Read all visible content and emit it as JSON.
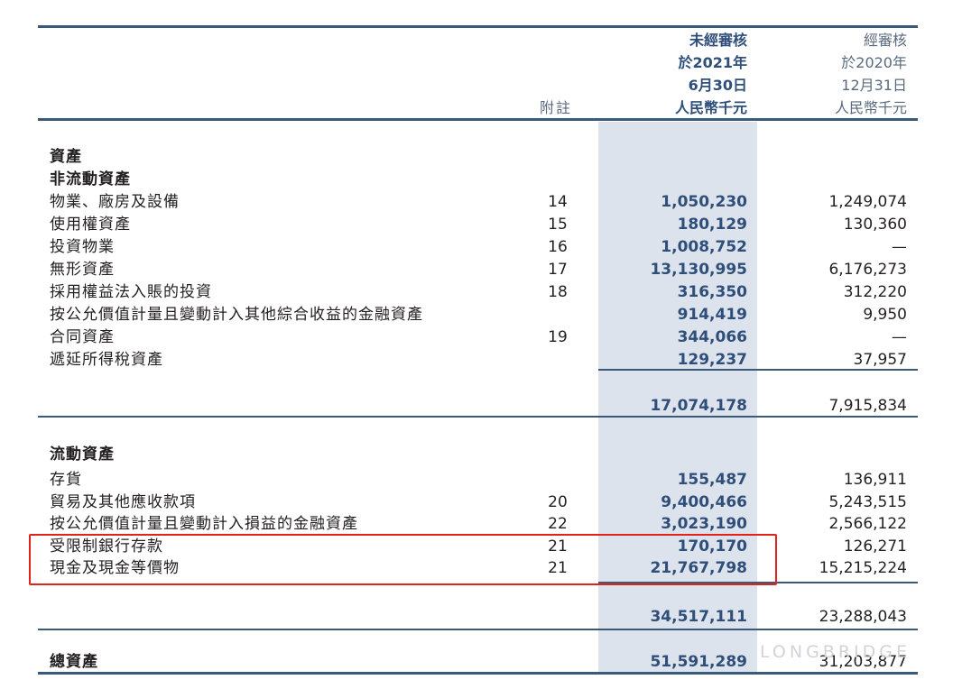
{
  "header": {
    "current": [
      "未經審核",
      "於2021年",
      "6月30日",
      "人民幣千元"
    ],
    "prior": [
      "經審核",
      "於2020年",
      "12月31日",
      "人民幣千元"
    ],
    "note_label": "附註"
  },
  "assets_heading": "資產",
  "noncurrent": {
    "heading": "非流動資產",
    "rows": [
      {
        "label": "物業、廠房及設備",
        "note": "14",
        "current": "1,050,230",
        "prior": "1,249,074"
      },
      {
        "label": "使用權資產",
        "note": "15",
        "current": "180,129",
        "prior": "130,360"
      },
      {
        "label": "投資物業",
        "note": "16",
        "current": "1,008,752",
        "prior": "—"
      },
      {
        "label": "無形資產",
        "note": "17",
        "current": "13,130,995",
        "prior": "6,176,273"
      },
      {
        "label": "採用權益法入賬的投資",
        "note": "18",
        "current": "316,350",
        "prior": "312,220"
      },
      {
        "label": "按公允價值計量且變動計入其他綜合收益的金融資產",
        "note": "",
        "current": "914,419",
        "prior": "9,950"
      },
      {
        "label": "合同資產",
        "note": "19",
        "current": "344,066",
        "prior": "—"
      },
      {
        "label": "遞延所得稅資產",
        "note": "",
        "current": "129,237",
        "prior": "37,957"
      }
    ],
    "subtotal_current": "17,074,178",
    "subtotal_prior": "7,915,834"
  },
  "currentassets": {
    "heading": "流動資產",
    "rows": [
      {
        "label": "存貨",
        "note": "",
        "current": "155,487",
        "prior": "136,911"
      },
      {
        "label": "貿易及其他應收款項",
        "note": "20",
        "current": "9,400,466",
        "prior": "5,243,515"
      },
      {
        "label": "按公允價值計量且變動計入損益的金融資產",
        "note": "22",
        "current": "3,023,190",
        "prior": "2,566,122"
      },
      {
        "label": "受限制銀行存款",
        "note": "21",
        "current": "170,170",
        "prior": "126,271"
      },
      {
        "label": "現金及現金等價物",
        "note": "21",
        "current": "21,767,798",
        "prior": "15,215,224"
      }
    ],
    "subtotal_current": "34,517,111",
    "subtotal_prior": "23,288,043"
  },
  "total": {
    "label": "總資產",
    "current": "51,591,289",
    "prior": "31,203,877"
  },
  "watermark": "LONGBRIDGE"
}
